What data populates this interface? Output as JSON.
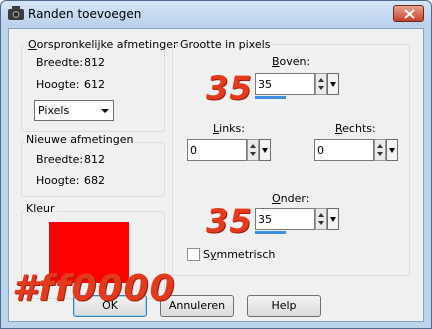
{
  "window": {
    "title": "Randen toevoegen",
    "close_icon": "close-x-icon"
  },
  "original_size": {
    "title": "Oorspronkelijke afmetingen",
    "width_label": "Breedte:",
    "width_value": "812",
    "height_label": "Hoogte:",
    "height_value": "612",
    "units_select": "Pixels"
  },
  "new_size": {
    "title": "Nieuwe afmetingen",
    "width_label": "Breedte:",
    "width_value": "812",
    "height_label": "Hoogte:",
    "height_value": "682"
  },
  "color": {
    "title": "Kleur",
    "value": "#ff0000",
    "overlay_hex": "#ff0000"
  },
  "border_size": {
    "title": "Grootte in pixels",
    "top": {
      "label": "Boven:",
      "value": "35",
      "annotation": "35"
    },
    "left": {
      "label": "Links:",
      "value": "0"
    },
    "right": {
      "label": "Rechts:",
      "value": "0"
    },
    "bottom": {
      "label": "Onder:",
      "value": "35",
      "annotation": "35"
    },
    "symmetric_label": "Symmetrisch",
    "symmetric_checked": false
  },
  "buttons": {
    "ok": "OK",
    "cancel": "Annuleren",
    "help": "Help"
  },
  "colors": {
    "annotation": "#e33a1e",
    "swatch": "#ff0000",
    "spin_bar": "#3c8ee0"
  }
}
